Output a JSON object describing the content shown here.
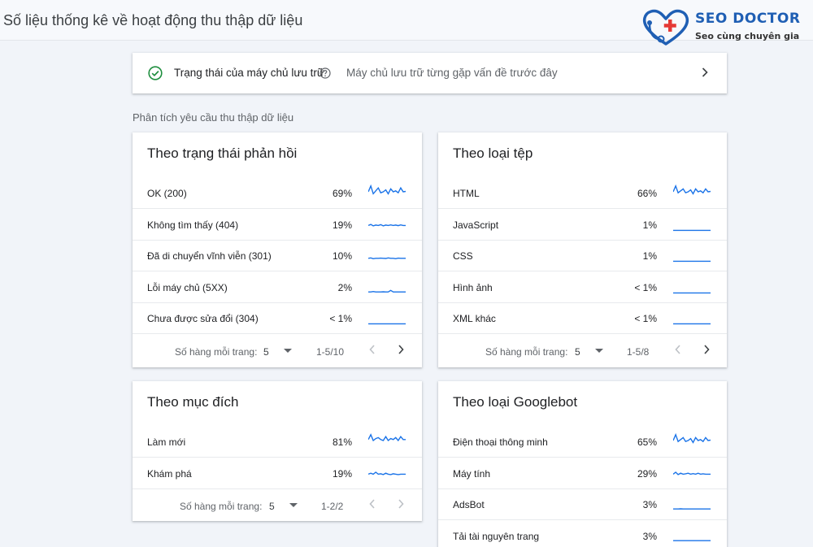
{
  "page": {
    "title": "Số liệu thống kê về hoạt động thu thập dữ liệu"
  },
  "logo": {
    "name": "SEO DOCTOR",
    "tagline": "Seo cùng chuyên gia",
    "brand_color": "#1f5fb4",
    "accent_color": "#e53935"
  },
  "host_status": {
    "label": "Trạng thái của máy chủ lưu trữ",
    "description": "Máy chủ lưu trữ từng gặp vấn đề trước đây",
    "status_color": "#1e8e3e"
  },
  "section": {
    "label": "Phân tích yêu cầu thu thập dữ liệu"
  },
  "line_color": "#1a73e8",
  "cards": {
    "response": {
      "title": "Theo trạng thái phản hồi",
      "rows": [
        {
          "label": "OK (200)",
          "pct": "69%",
          "trend": [
            0.5,
            0.2,
            0.6,
            0.45,
            0.3,
            0.55,
            0.5,
            0.4,
            0.6,
            0.35,
            0.5,
            0.45,
            0.55,
            0.3,
            0.5,
            0.48
          ]
        },
        {
          "label": "Không tìm thấy (404)",
          "pct": "19%",
          "trend": [
            0.6,
            0.55,
            0.62,
            0.58,
            0.6,
            0.56,
            0.62,
            0.58,
            0.6,
            0.57,
            0.6,
            0.58,
            0.61,
            0.57,
            0.6,
            0.6
          ]
        },
        {
          "label": "Đã di chuyển vĩnh viễn (301)",
          "pct": "10%",
          "trend": [
            0.7,
            0.68,
            0.72,
            0.7,
            0.7,
            0.69,
            0.7,
            0.71,
            0.68,
            0.7,
            0.7,
            0.72,
            0.69,
            0.7,
            0.7,
            0.7
          ]
        },
        {
          "label": "Lỗi máy chủ (5XX)",
          "pct": "2%",
          "trend": [
            0.8,
            0.8,
            0.78,
            0.8,
            0.8,
            0.8,
            0.79,
            0.8,
            0.8,
            0.72,
            0.8,
            0.8,
            0.8,
            0.8,
            0.8,
            0.8
          ]
        },
        {
          "label": "Chưa được sửa đổi (304)",
          "pct": "< 1%",
          "trend": [
            0.85,
            0.85,
            0.85,
            0.85,
            0.85,
            0.85,
            0.85,
            0.85,
            0.85,
            0.85,
            0.85,
            0.85,
            0.85,
            0.85,
            0.85,
            0.85
          ]
        }
      ],
      "pager": {
        "rows_label": "Số hàng mỗi trang:",
        "page_size": "5",
        "range": "1-5/10"
      }
    },
    "filetype": {
      "title": "Theo loại tệp",
      "rows": [
        {
          "label": "HTML",
          "pct": "66%",
          "trend": [
            0.5,
            0.2,
            0.55,
            0.45,
            0.35,
            0.55,
            0.5,
            0.4,
            0.6,
            0.35,
            0.5,
            0.45,
            0.55,
            0.35,
            0.5,
            0.48
          ]
        },
        {
          "label": "JavaScript",
          "pct": "1%",
          "trend": [
            0.85,
            0.85,
            0.85,
            0.85,
            0.85,
            0.85,
            0.85,
            0.85,
            0.85,
            0.85,
            0.85,
            0.85,
            0.85,
            0.85,
            0.85,
            0.85
          ]
        },
        {
          "label": "CSS",
          "pct": "1%",
          "trend": [
            0.85,
            0.85,
            0.85,
            0.85,
            0.85,
            0.85,
            0.85,
            0.85,
            0.85,
            0.85,
            0.85,
            0.85,
            0.85,
            0.85,
            0.85,
            0.85
          ]
        },
        {
          "label": "Hình ảnh",
          "pct": "< 1%",
          "trend": [
            0.85,
            0.85,
            0.85,
            0.85,
            0.85,
            0.85,
            0.85,
            0.85,
            0.85,
            0.85,
            0.85,
            0.85,
            0.85,
            0.85,
            0.85,
            0.85
          ]
        },
        {
          "label": "XML khác",
          "pct": "< 1%",
          "trend": [
            0.85,
            0.85,
            0.85,
            0.85,
            0.85,
            0.85,
            0.85,
            0.85,
            0.85,
            0.85,
            0.85,
            0.85,
            0.85,
            0.85,
            0.85,
            0.85
          ]
        }
      ],
      "pager": {
        "rows_label": "Số hàng mỗi trang:",
        "page_size": "5",
        "range": "1-5/8"
      }
    },
    "purpose": {
      "title": "Theo mục đích",
      "rows": [
        {
          "label": "Làm mới",
          "pct": "81%",
          "trend": [
            0.45,
            0.2,
            0.5,
            0.4,
            0.35,
            0.45,
            0.5,
            0.3,
            0.5,
            0.4,
            0.45,
            0.35,
            0.5,
            0.3,
            0.45,
            0.45
          ]
        },
        {
          "label": "Khám phá",
          "pct": "19%",
          "trend": [
            0.6,
            0.55,
            0.6,
            0.5,
            0.6,
            0.58,
            0.62,
            0.55,
            0.6,
            0.62,
            0.58,
            0.6,
            0.62,
            0.6,
            0.6,
            0.6
          ]
        }
      ],
      "pager": {
        "rows_label": "Số hàng mỗi trang:",
        "page_size": "5",
        "range": "1-2/2"
      }
    },
    "googlebot": {
      "title": "Theo loại Googlebot",
      "rows": [
        {
          "label": "Điện thoại thông minh",
          "pct": "65%",
          "trend": [
            0.5,
            0.2,
            0.55,
            0.45,
            0.35,
            0.55,
            0.5,
            0.4,
            0.6,
            0.35,
            0.5,
            0.45,
            0.55,
            0.35,
            0.5,
            0.48
          ]
        },
        {
          "label": "Máy tính",
          "pct": "29%",
          "trend": [
            0.6,
            0.5,
            0.62,
            0.55,
            0.6,
            0.58,
            0.55,
            0.6,
            0.57,
            0.6,
            0.55,
            0.6,
            0.58,
            0.6,
            0.6,
            0.6
          ]
        },
        {
          "label": "AdsBot",
          "pct": "3%",
          "trend": [
            0.8,
            0.8,
            0.8,
            0.79,
            0.8,
            0.8,
            0.8,
            0.8,
            0.8,
            0.8,
            0.8,
            0.8,
            0.8,
            0.8,
            0.8,
            0.8
          ]
        },
        {
          "label": "Tải tài nguyên trang",
          "pct": "3%",
          "trend": [
            0.8,
            0.8,
            0.8,
            0.8,
            0.8,
            0.8,
            0.8,
            0.8,
            0.8,
            0.8,
            0.8,
            0.8,
            0.8,
            0.8,
            0.8,
            0.8
          ]
        }
      ]
    }
  }
}
